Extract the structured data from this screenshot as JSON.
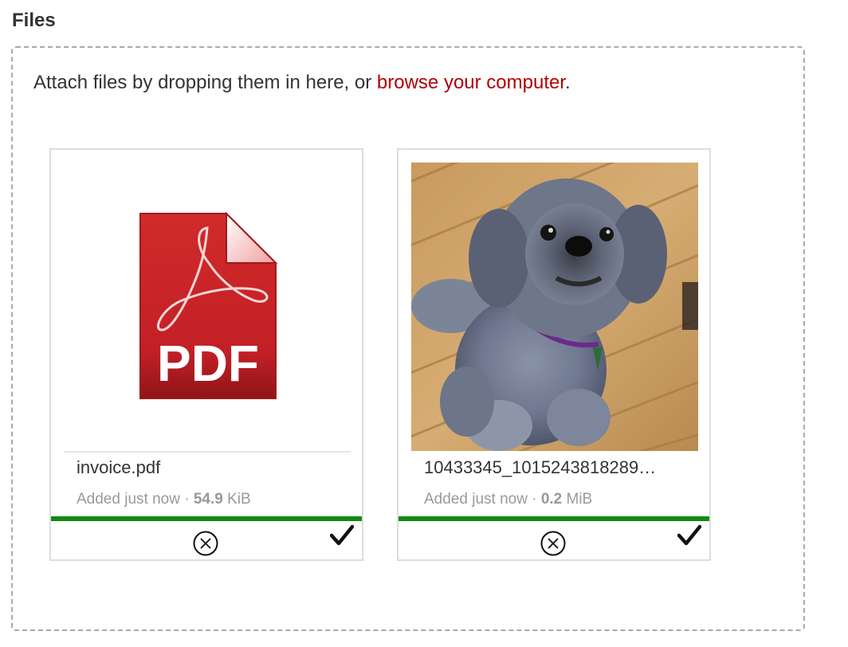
{
  "section": {
    "title": "Files"
  },
  "dropzone": {
    "text_before": "Attach files by dropping them in here, or ",
    "browse_label": "browse your computer",
    "text_after": ".",
    "link_color": "#b30000"
  },
  "files": [
    {
      "name": "invoice.pdf",
      "added_label": "Added just now",
      "separator": " · ",
      "size_value": "54.9",
      "size_unit": " KiB",
      "thumbnail_icon": "pdf-file-icon",
      "thumbnail_text": "PDF",
      "progress": 1.0,
      "status_icon": "check-icon",
      "remove_icon": "circle-x-icon"
    },
    {
      "name": "10433345_1015243818289…",
      "added_label": "Added just now",
      "separator": " · ",
      "size_value": "0.2",
      "size_unit": " MiB",
      "thumbnail_icon": "photo-thumbnail",
      "progress": 1.0,
      "status_icon": "check-icon",
      "remove_icon": "circle-x-icon"
    }
  ],
  "colors": {
    "progress": "#118811",
    "pdf_red": "#c9242b",
    "meta_gray": "#999999"
  }
}
